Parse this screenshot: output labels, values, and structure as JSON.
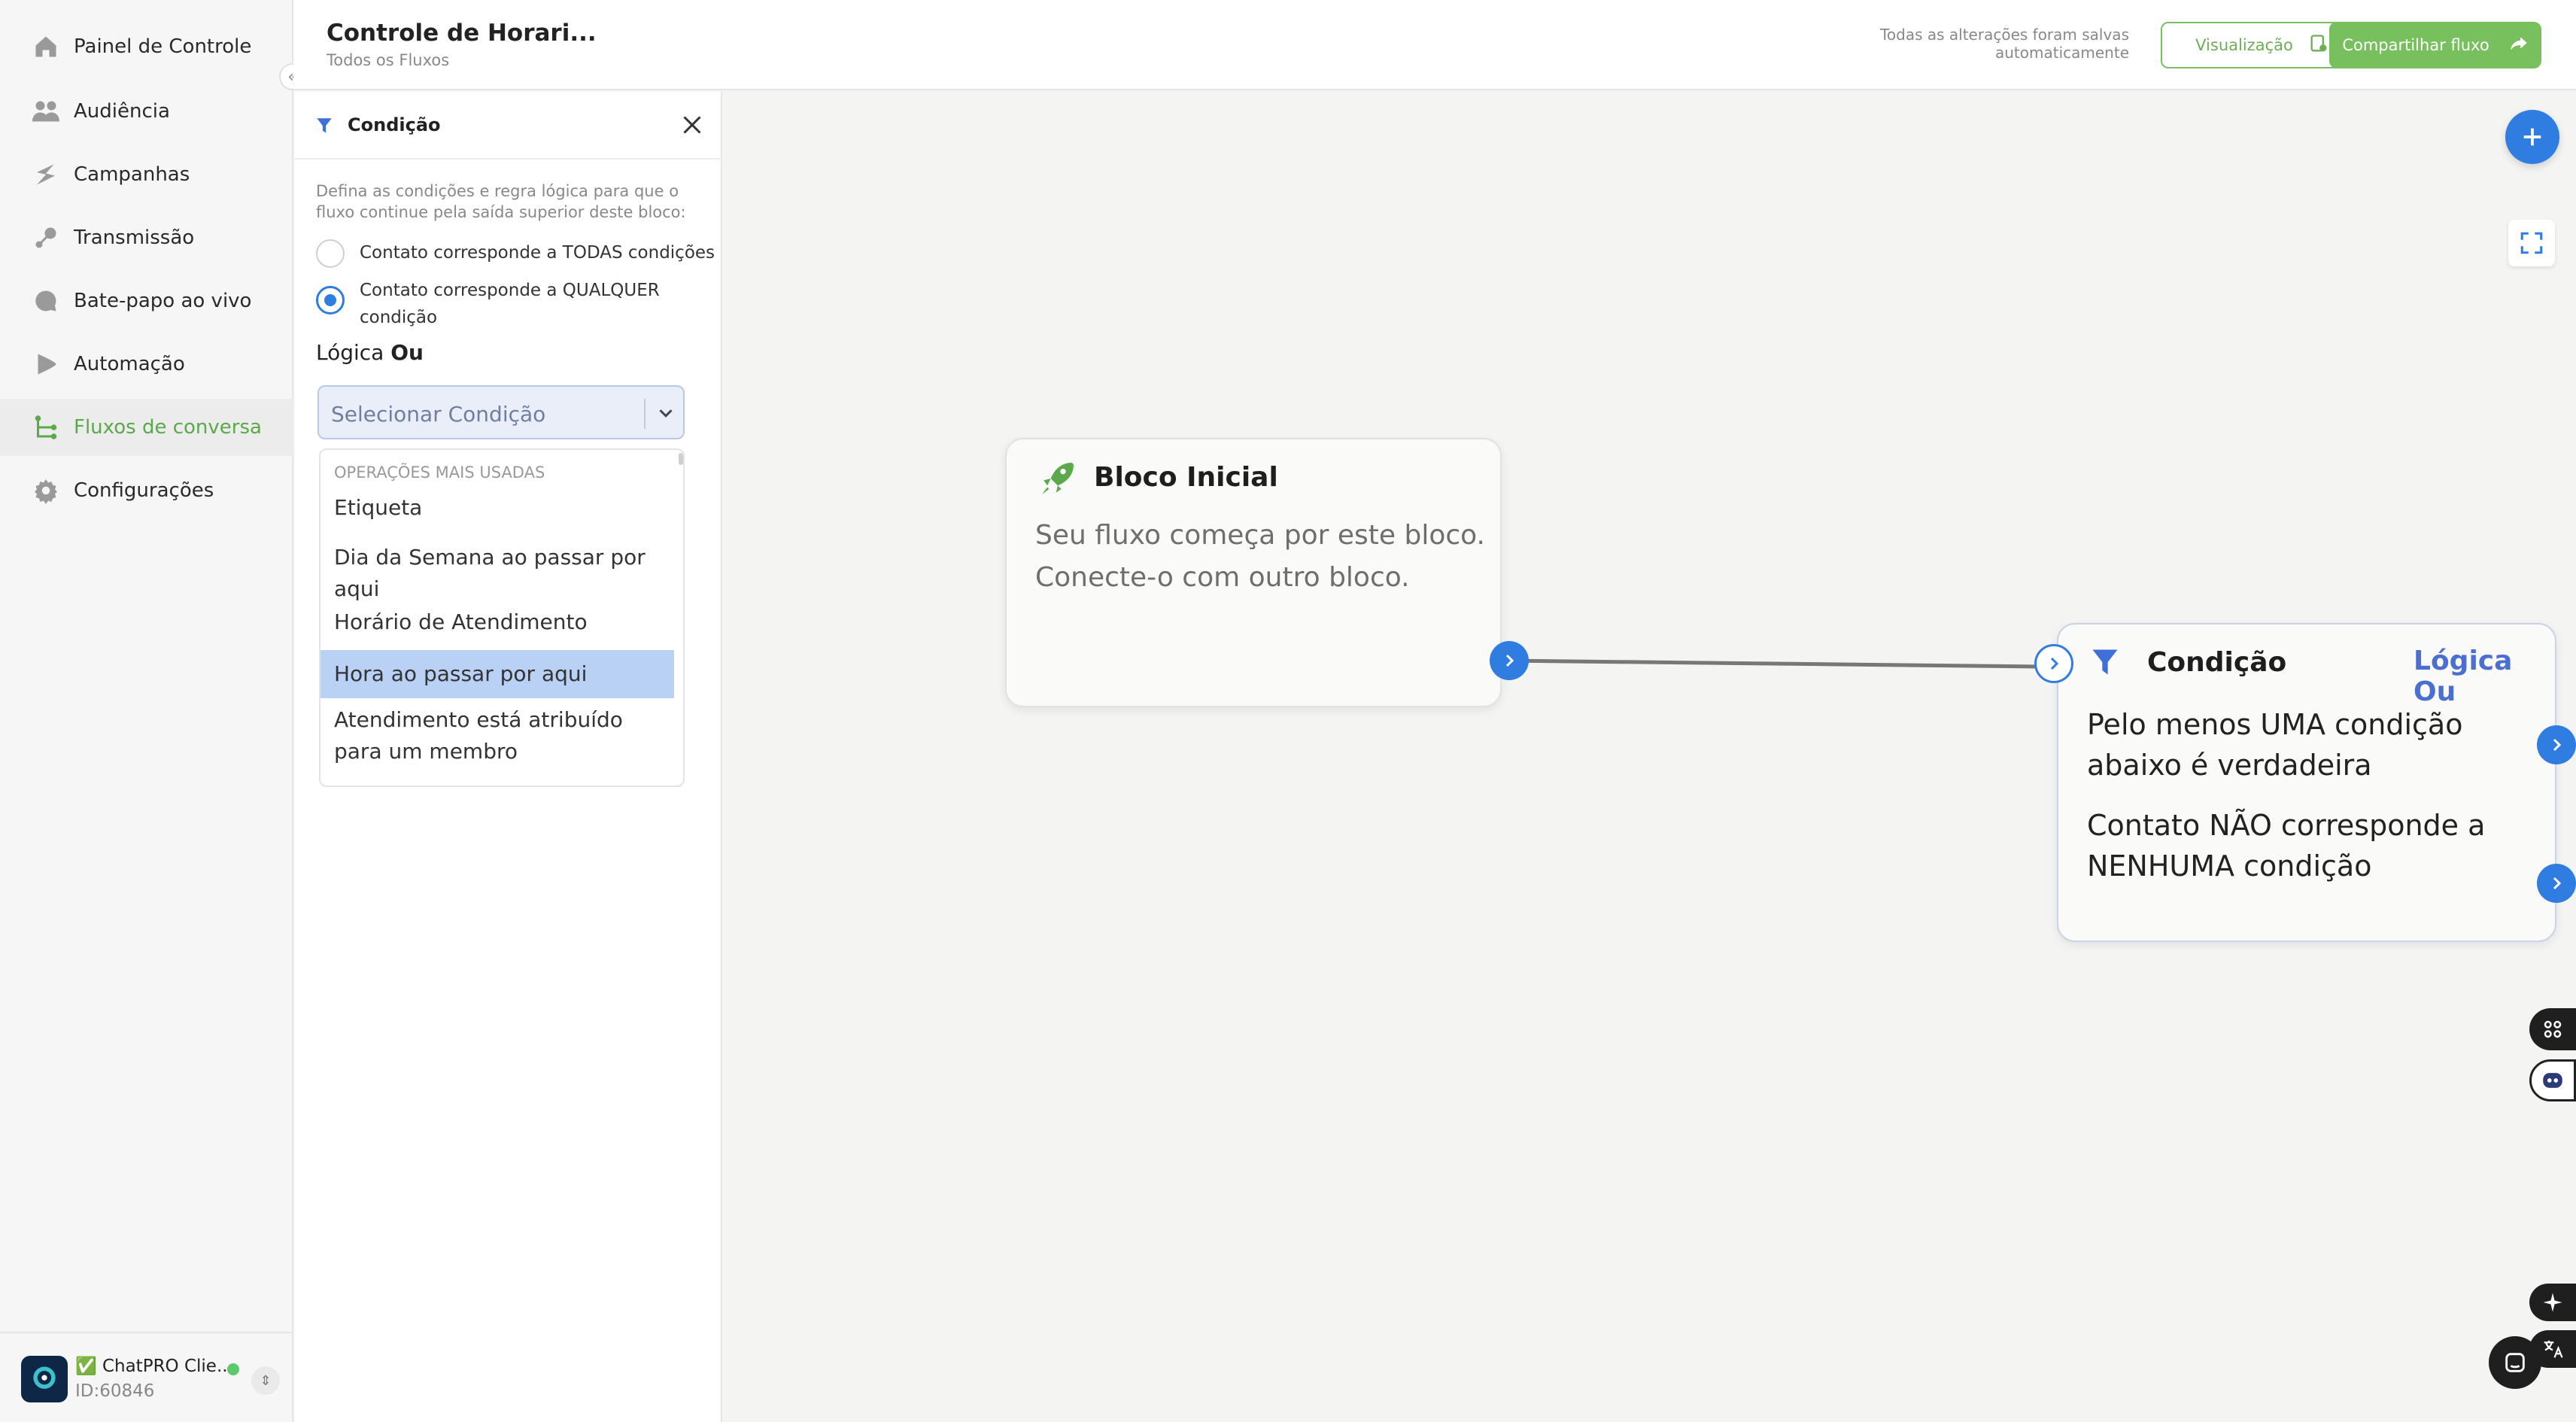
{
  "sidebar": {
    "items": [
      {
        "label": "Painel de Controle",
        "icon": "home-icon"
      },
      {
        "label": "Audiência",
        "icon": "users-icon"
      },
      {
        "label": "Campanhas",
        "icon": "campaign-icon"
      },
      {
        "label": "Transmissão",
        "icon": "broadcast-icon"
      },
      {
        "label": "Bate-papo ao vivo",
        "icon": "chat-bubble-icon"
      },
      {
        "label": "Automação",
        "icon": "play-icon"
      },
      {
        "label": "Fluxos de conversa",
        "icon": "flow-icon"
      },
      {
        "label": "Configurações",
        "icon": "gear-icon"
      }
    ],
    "active_index": 6,
    "collapse_icon": "double-chevron-left-icon",
    "account": {
      "name": "✅ ChatPRO Clie...",
      "id": "ID:60846",
      "status_color": "#5cc96b"
    }
  },
  "header": {
    "title": "Controle de Horari...",
    "breadcrumb": "Todos os Fluxos",
    "save_status": "Todas as alterações foram salvas automaticamente",
    "preview_label": "Visualização",
    "share_label": "Compartilhar fluxo"
  },
  "panel": {
    "title": "Condição",
    "description": "Defina as condições e regra lógica para que o fluxo continue pela saída superior deste bloco:",
    "radio_all": "Contato corresponde a TODAS condições",
    "radio_any": "Contato corresponde a QUALQUER condição",
    "logic_label": "Lógica",
    "logic_value": "Ou",
    "select_placeholder": "Selecionar Condição",
    "dropdown": {
      "header": "OPERAÇÕES MAIS USADAS",
      "items": [
        "Etiqueta",
        "Dia da Semana ao passar por aqui",
        "Horário de Atendimento",
        "Hora ao passar por aqui",
        "Atendimento está atribuído para um membro"
      ],
      "highlighted_index": 3
    }
  },
  "canvas": {
    "start_block": {
      "title": "Bloco Inicial",
      "text": "Seu fluxo começa por este bloco. Conecte-o com outro bloco."
    },
    "condition_block": {
      "title": "Condição",
      "logic": "Lógica Ou",
      "line1": "Pelo menos UMA condição abaixo é verdadeira",
      "line2": "Contato NÃO corresponde a NENHUMA condição"
    }
  },
  "colors": {
    "accent_blue": "#2f7de1",
    "accent_green": "#78c05e",
    "highlight": "#b9d1f4"
  }
}
